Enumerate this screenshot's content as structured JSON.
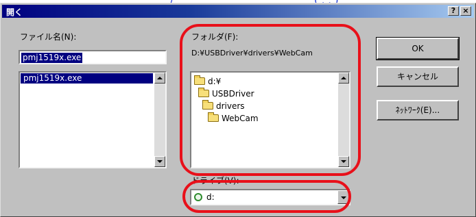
{
  "caption": {
    "left": "/",
    "right": "(       , ,       )"
  },
  "window": {
    "title": "開く",
    "help_button": "?",
    "close_button": "×"
  },
  "file_name": {
    "label": "ファイル名(N):",
    "value": "pmj1519x.exe",
    "list_items": [
      "pmj1519x.exe"
    ]
  },
  "folder": {
    "label": "フォルダ(F):",
    "path": "D:¥USBDriver¥drivers¥WebCam",
    "tree": [
      {
        "label": "d:¥",
        "open": true
      },
      {
        "label": "USBDriver",
        "open": true
      },
      {
        "label": "drivers",
        "open": true
      },
      {
        "label": "WebCam",
        "open": true
      }
    ]
  },
  "drive": {
    "label": "ドライブ(V):",
    "value": "d:"
  },
  "buttons": {
    "ok": "OK",
    "cancel": "キャンセル",
    "network": "ﾈｯﾄﾜｰｸ(E)..."
  },
  "colors": {
    "highlight": "#e8101a",
    "titlebar": "#000080",
    "dialog_face": "#c0c0c0",
    "caption_text": "#1e3ad8"
  },
  "icons": {
    "folder": "folder-icon",
    "drive": "disk-drive-icon"
  }
}
